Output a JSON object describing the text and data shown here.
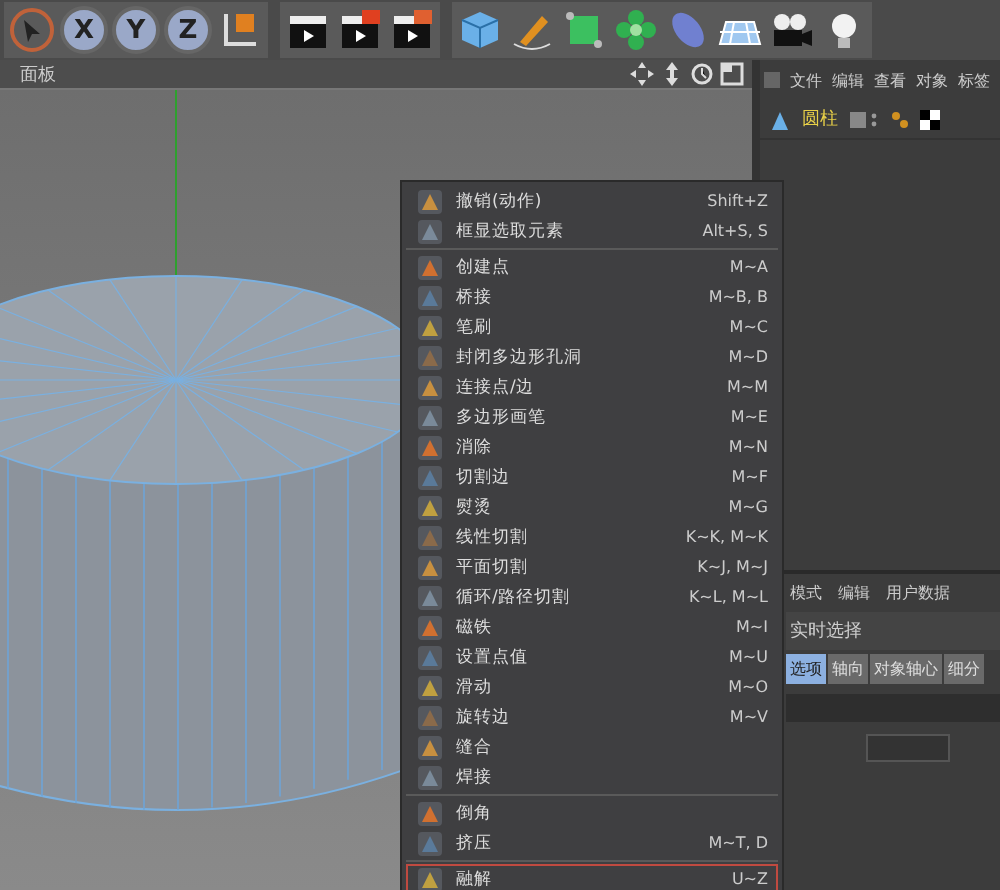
{
  "toolbar": {
    "axis_buttons": [
      "X",
      "Y",
      "Z"
    ]
  },
  "viewport": {
    "menu_label": "面板"
  },
  "context_menu": {
    "groups": [
      [
        {
          "label": "撤销(动作)",
          "shortcut": "Shift+Z",
          "selected": false
        },
        {
          "label": "框显选取元素",
          "shortcut": "Alt+S, S",
          "selected": false
        }
      ],
      [
        {
          "label": "创建点",
          "shortcut": "M~A",
          "selected": false
        },
        {
          "label": "桥接",
          "shortcut": "M~B, B",
          "selected": false
        },
        {
          "label": "笔刷",
          "shortcut": "M~C",
          "selected": false
        },
        {
          "label": "封闭多边形孔洞",
          "shortcut": "M~D",
          "selected": false
        },
        {
          "label": "连接点/边",
          "shortcut": "M~M",
          "selected": false
        },
        {
          "label": "多边形画笔",
          "shortcut": "M~E",
          "selected": false
        },
        {
          "label": "消除",
          "shortcut": "M~N",
          "selected": false
        },
        {
          "label": "切割边",
          "shortcut": "M~F",
          "selected": false
        },
        {
          "label": "熨烫",
          "shortcut": "M~G",
          "selected": false
        },
        {
          "label": "线性切割",
          "shortcut": "K~K, M~K",
          "selected": false
        },
        {
          "label": "平面切割",
          "shortcut": "K~J, M~J",
          "selected": false
        },
        {
          "label": "循环/路径切割",
          "shortcut": "K~L, M~L",
          "selected": false
        },
        {
          "label": "磁铁",
          "shortcut": "M~I",
          "selected": false
        },
        {
          "label": "设置点值",
          "shortcut": "M~U",
          "selected": false
        },
        {
          "label": "滑动",
          "shortcut": "M~O",
          "selected": false
        },
        {
          "label": "旋转边",
          "shortcut": "M~V",
          "selected": false
        },
        {
          "label": "缝合",
          "selected": false
        },
        {
          "label": "焊接",
          "selected": false
        }
      ],
      [
        {
          "label": "倒角",
          "selected": false
        },
        {
          "label": "挤压",
          "shortcut": "M~T, D",
          "selected": false
        }
      ],
      [
        {
          "label": "融解",
          "shortcut": "U~Z",
          "selected": true
        }
      ]
    ]
  },
  "object_manager": {
    "menu": [
      "文件",
      "编辑",
      "查看",
      "对象",
      "标签"
    ],
    "objects": [
      {
        "name": "圆柱"
      }
    ]
  },
  "attributes": {
    "menu": [
      "模式",
      "编辑",
      "用户数据"
    ],
    "tool": "实时选择",
    "tabs": [
      {
        "label": "选项",
        "selected": true
      },
      {
        "label": "轴向",
        "selected": false
      },
      {
        "label": "对象轴心",
        "selected": false
      },
      {
        "label": "细分",
        "selected": false
      }
    ]
  }
}
